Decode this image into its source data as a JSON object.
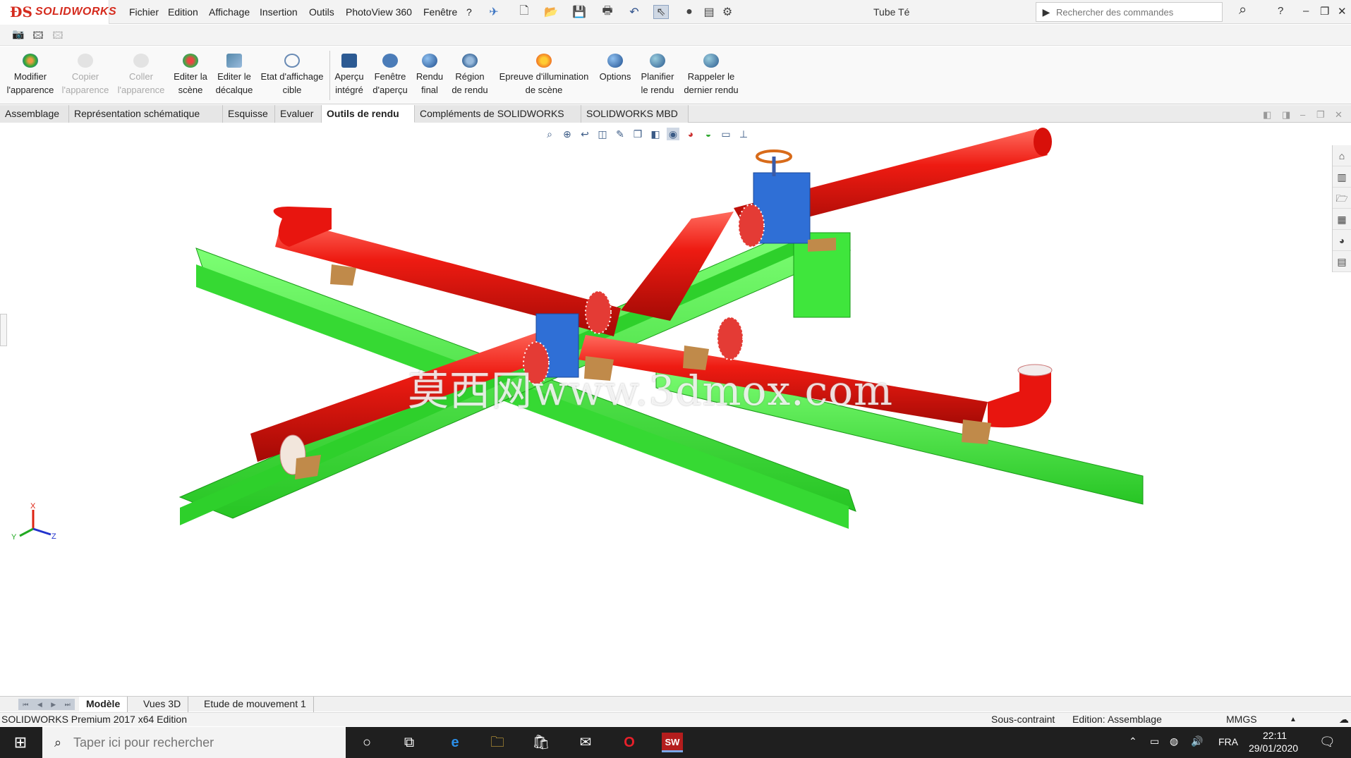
{
  "app": {
    "brand": "SOLIDWORKS",
    "menu": [
      "Fichier",
      "Edition",
      "Affichage",
      "Insertion",
      "Outils",
      "PhotoView 360",
      "Fenêtre",
      "?"
    ],
    "doc_title": "Tube Té",
    "search_placeholder": "Rechercher des commandes",
    "help": "?"
  },
  "ribbon": {
    "buttons": [
      {
        "line1": "Modifier",
        "line2": "l'apparence",
        "enabled": true,
        "icon": "appearance-icon"
      },
      {
        "line1": "Copier",
        "line2": "l'apparence",
        "enabled": false,
        "icon": "copy-appearance-icon"
      },
      {
        "line1": "Coller",
        "line2": "l'apparence",
        "enabled": false,
        "icon": "paste-appearance-icon"
      },
      {
        "line1": "Editer la",
        "line2": "scène",
        "enabled": true,
        "icon": "scene-icon"
      },
      {
        "line1": "Editer le",
        "line2": "décalque",
        "enabled": true,
        "icon": "decal-icon"
      },
      {
        "line1": "Etat d'affichage",
        "line2": "cible",
        "enabled": true,
        "icon": "display-state-icon"
      },
      {
        "line1": "Aperçu",
        "line2": "intégré",
        "enabled": true,
        "icon": "integrated-preview-icon"
      },
      {
        "line1": "Fenêtre",
        "line2": "d'aperçu",
        "enabled": true,
        "icon": "preview-window-icon"
      },
      {
        "line1": "Rendu",
        "line2": "final",
        "enabled": true,
        "icon": "final-render-icon"
      },
      {
        "line1": "Région",
        "line2": "de rendu",
        "enabled": true,
        "icon": "render-region-icon"
      },
      {
        "line1": "Epreuve d'illumination",
        "line2": "de scène",
        "enabled": true,
        "icon": "illumination-icon"
      },
      {
        "line1": "Options",
        "line2": "",
        "enabled": true,
        "icon": "options-icon"
      },
      {
        "line1": "Planifier",
        "line2": "le rendu",
        "enabled": true,
        "icon": "schedule-render-icon"
      },
      {
        "line1": "Rappeler le",
        "line2": "dernier rendu",
        "enabled": true,
        "icon": "recall-render-icon"
      }
    ]
  },
  "tabs": [
    "Assemblage",
    "Représentation schématique",
    "Esquisse",
    "Evaluer",
    "Outils de rendu",
    "Compléments de SOLIDWORKS",
    "SOLIDWORKS MBD"
  ],
  "active_tab": "Outils de rendu",
  "viewport": {
    "watermark": "莫西网www.3dmox.com",
    "triad": {
      "x": "X",
      "y": "Y",
      "z": "Z"
    },
    "colors": {
      "pipe": "#e8150f",
      "beam": "#3cf03a",
      "valve": "#2f6fd6",
      "support": "#c08a4a"
    }
  },
  "bottom_tabs": [
    "Modèle",
    "Vues 3D",
    "Etude de mouvement 1"
  ],
  "status": {
    "product": "SOLIDWORKS Premium 2017 x64 Edition",
    "constraint": "Sous-contraint",
    "edit_mode": "Edition: Assemblage",
    "units": "MMGS"
  },
  "taskbar": {
    "search_placeholder": "Taper ici pour rechercher",
    "lang": "FRA",
    "time": "22:11",
    "date": "29/01/2020"
  }
}
